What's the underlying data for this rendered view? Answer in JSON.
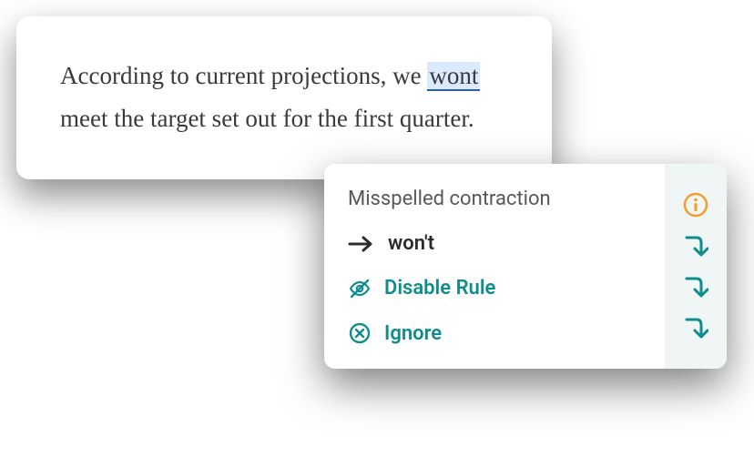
{
  "editor": {
    "text_before": "According to current projections, we ",
    "highlighted_word": "wont",
    "text_after": " meet the target set out for the first quarter."
  },
  "suggestion": {
    "title": "Misspelled contraction",
    "correction": "won't",
    "actions": {
      "disable_rule": "Disable Rule",
      "ignore": "Ignore"
    }
  },
  "colors": {
    "teal": "#0f8c8c",
    "orange": "#f0a030",
    "highlight_bg": "#dceaff",
    "highlight_border": "#2f5f9e"
  }
}
